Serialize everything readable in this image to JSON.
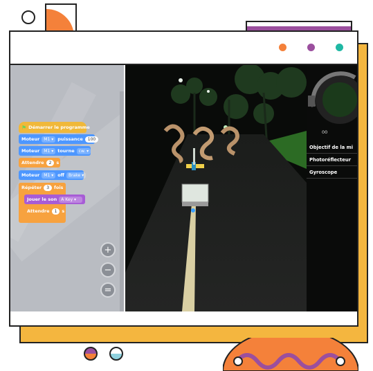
{
  "window": {
    "dots": [
      "#f4813a",
      "#9b4f9e",
      "#1fb8a4"
    ]
  },
  "blocks": {
    "start": "Démarrer le programme",
    "motor_power": {
      "label": "Moteur",
      "motor": "M1",
      "word": "puissance",
      "value": "100"
    },
    "motor_turn": {
      "label": "Moteur",
      "motor": "M1",
      "word": "tourne",
      "dir": "cw."
    },
    "wait1": {
      "label": "Attendre",
      "value": "2",
      "unit": "s"
    },
    "motor_off": {
      "label": "Moteur",
      "motor": "M1",
      "word": "off",
      "mode": "Brake"
    },
    "repeat": {
      "label": "Répéter",
      "value": "3",
      "unit": "fois"
    },
    "sound": {
      "label": "Jouer le son",
      "value": "A Key"
    },
    "wait2": {
      "label": "Attendre",
      "value": "1",
      "unit": "s"
    }
  },
  "zoom_icons": [
    "zoom-in-icon",
    "zoom-out-icon",
    "zoom-reset-icon"
  ],
  "scene": {
    "timer": "00",
    "panel_items": [
      "Objectif de la mi",
      "Photoréflecteur",
      "Gyroscope"
    ]
  },
  "colors": {
    "orange": "#f4813a",
    "purple": "#9b4f9e",
    "yellow": "#f4b63f",
    "teal": "#1fb8a4"
  }
}
